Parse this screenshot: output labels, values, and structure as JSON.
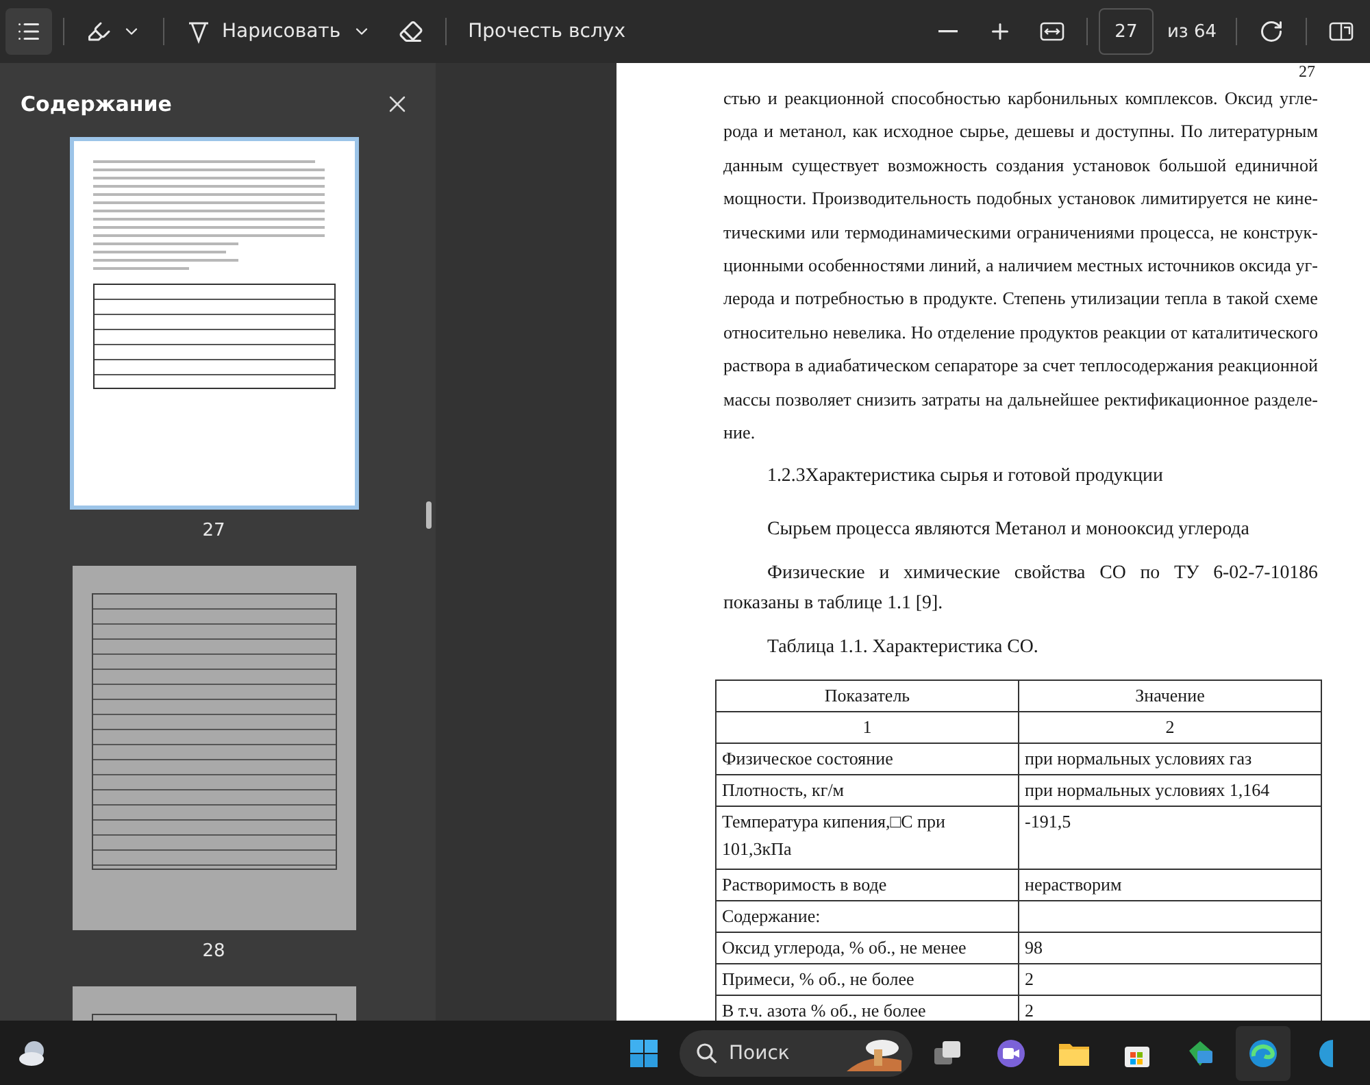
{
  "toolbar": {
    "contents_selected": true,
    "draw_label": "Нарисовать",
    "read_aloud": "Прочесть вслух",
    "page_input": "27",
    "page_total": "из 64"
  },
  "sidebar": {
    "title": "Содержание",
    "thumbnails": [
      {
        "label": "27",
        "selected": true
      },
      {
        "label": "28",
        "selected": false
      },
      {
        "selected": false
      }
    ]
  },
  "document": {
    "page_number": "27",
    "paragraph_lines": [
      "стью и реакционной способностью карбонильных комплексов. Оксид угле-",
      "рода и метанол, как исходное сырье, дешевы и доступны. По литературным",
      "данным существует возможность создания установок большой единичной",
      "мощности. Производительность подобных установок лимитируется не кине-",
      "тическими или термодинамическими ограничениями процесса, не конструк-",
      "ционными особенностями линий, а наличием местных источников оксида уг-",
      "лерода и потребностью в продукте. Степень утилизации тепла в такой схеме",
      "относительно невелика. Но отделение продуктов реакции от каталитического",
      "раствора в адиабатическом сепараторе за счет теплосодержания реакционной",
      "массы позволяет снизить затраты на дальнейшее ректификационное разделе-",
      "ние."
    ],
    "heading": "1.2.3Характеристика сырья и готовой продукции",
    "paragraphs": [
      "Сырьем процесса являются Метанол и монооксид углерода",
      "Физические и химические свойства СО по ТУ 6-02-7-10186 показаны в таблице 1.1 [9]."
    ],
    "table_caption": "Таблица 1.1. Характеристика СО.",
    "table": {
      "columns": [
        "Показатель",
        "Значение"
      ],
      "rows": [
        {
          "kind": "center",
          "cells": [
            "1",
            "2"
          ]
        },
        {
          "kind": "left",
          "cells": [
            "Физическое состояние",
            "при нормальных условиях газ"
          ]
        },
        {
          "kind": "left",
          "cells": [
            "Плотность, кг/м",
            "при нормальных условиях 1,164"
          ]
        },
        {
          "kind": "left",
          "cells": [
            "Температура кипения,□С при 101,3кПа",
            "-191,5"
          ]
        },
        {
          "kind": "left",
          "cells": [
            "Растворимость в воде",
            "нерастворим"
          ]
        },
        {
          "kind": "left",
          "cells": [
            "Содержание:",
            ""
          ]
        },
        {
          "kind": "left",
          "cells": [
            "Оксид углерода, % об., не менее",
            "98"
          ]
        },
        {
          "kind": "left",
          "cells": [
            "Примеси, % об., не более",
            "2"
          ]
        },
        {
          "kind": "left",
          "cells": [
            "В т.ч. азота % об., не более",
            "2"
          ]
        }
      ]
    }
  },
  "taskbar": {
    "search_placeholder": "Поиск"
  }
}
